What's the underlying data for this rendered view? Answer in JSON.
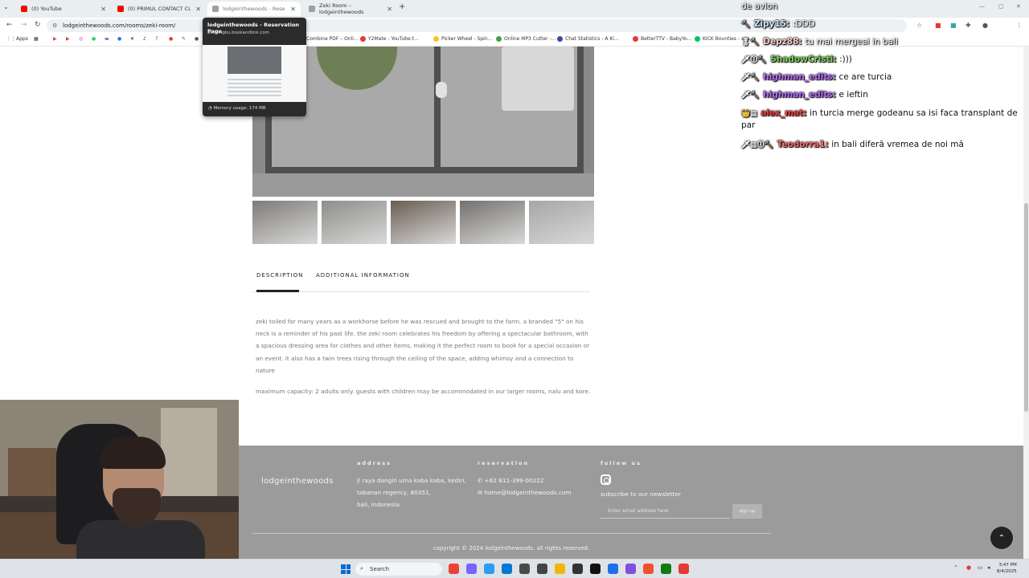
{
  "browser": {
    "tabs": [
      {
        "title": "(0) YouTube",
        "color": "#ff0000"
      },
      {
        "title": "(0) PRIMUL CONTACT CU TIKIX…",
        "color": "#ff0000"
      },
      {
        "title": "lodgeinthewoods - Reservation…",
        "color": "#9aa0a6"
      },
      {
        "title": "Zeki Room – lodgeinthewoods",
        "color": "#9aa0a6"
      }
    ],
    "url": "lodgeinthewoods.com/rooms/zeki-room/",
    "bookmarks": [
      {
        "label": "Apps",
        "color": "#5f6368"
      },
      {
        "label": "Combine PDF – Onli…",
        "color": "#e53935"
      },
      {
        "label": "Y2Mate - YouTube t…",
        "color": "#e53935"
      },
      {
        "label": "Picker Wheel - Spin…",
        "color": "#fbc02d"
      },
      {
        "label": "Online MP3 Cutter -…",
        "color": "#43a047"
      },
      {
        "label": "Chat Statistics - A Ki…",
        "color": "#3949ab"
      },
      {
        "label": "BetterTTV - BabyYo…",
        "color": "#e53935"
      },
      {
        "label": "KICK Bounties - ava…",
        "color": "#00c853"
      }
    ]
  },
  "tooltip": {
    "title": "lodgeinthewoods - Reservation Page",
    "url": "bookingku.bookandlink.com",
    "memory": "Memory usage: 174 MB"
  },
  "page": {
    "tabs": {
      "description": "DESCRIPTION",
      "additional": "ADDITIONAL INFORMATION"
    },
    "description": "zeki toiled for many years as a workhorse before he was rescued and brought to the farm. a branded \"5\" on his neck is a reminder of his past life. the zeki room celebrates his freedom by offering a spectacular bathroom, with a spacious dressing area for clothes and other items, making it the perfect room to book for a special occasion or an event. it also has a twin trees rising through the ceiling of the space, adding whimsy and a connection to nature",
    "capacity": "maximum capacity: 2 adults only. guests with children may be accommodated in our larger rooms, nalu and kore.",
    "thumb_colors": [
      "#7d7b78",
      "#8e8d8a",
      "#6a5e52",
      "#73716e",
      "#a6a6a6"
    ]
  },
  "footer": {
    "logo": "lodgeinthewoods",
    "address_heading": "address",
    "address_lines": [
      "jl raya dangin uma kaba kaba, kediri,",
      "tabanan regency, 80351,",
      "bali, indonesia"
    ],
    "reservation_heading": "reservation",
    "phone": "+62 811-399-00222",
    "email": "home@lodgeinthewoods.com",
    "follow_heading": "follow us",
    "newsletter_label": "subscribe to our newsletter",
    "newsletter_placeholder": "Enter email address here",
    "signup_label": "sign up",
    "copyright": "copyright © 2024 lodgeinthewoods. all rights reserved."
  },
  "chat": [
    {
      "user": "",
      "color": "#ffffff",
      "message": "de avion",
      "badges": ""
    },
    {
      "user": "Zipy15:",
      "color": "#cfe8ff",
      "message": ":DDD",
      "badges": "🔨"
    },
    {
      "user": "Depz88:",
      "color": "#ffd0d0",
      "message": "tu mai mergeai in bali",
      "badges": "🎖🔨"
    },
    {
      "user": "ShadowCristi:",
      "color": "#7ed957",
      "message": ":)))",
      "badges": "🗡⓵🔨"
    },
    {
      "user": "highman_edits:",
      "color": "#b86bff",
      "message": "ce are turcia",
      "badges": "🗡🔨"
    },
    {
      "user": "highman_edits:",
      "color": "#b86bff",
      "message": "e ieftin",
      "badges": "🗡🔨"
    },
    {
      "user": "alex_mat:",
      "color": "#ff3b3b",
      "message": "in turcia merge godeanu sa isi faca transplant de par",
      "badges": "👑▦"
    },
    {
      "user": "Teodorra1:",
      "color": "#ff6f6f",
      "message": "in bali diferă vremea de noi mă",
      "badges": "🗡▦⓵🔨"
    }
  ],
  "taskbar": {
    "search_label": "Search",
    "time": "3:47 PM",
    "date": "8/4/2025",
    "app_colors": [
      "#ea4335",
      "#7b61ff",
      "#2a9df4",
      "#0078d4",
      "#4a4a4a",
      "#444444",
      "#f2b600",
      "#333333",
      "#111111",
      "#1f6feb",
      "#8250df",
      "#f05032",
      "#107c10",
      "#e53935"
    ]
  }
}
